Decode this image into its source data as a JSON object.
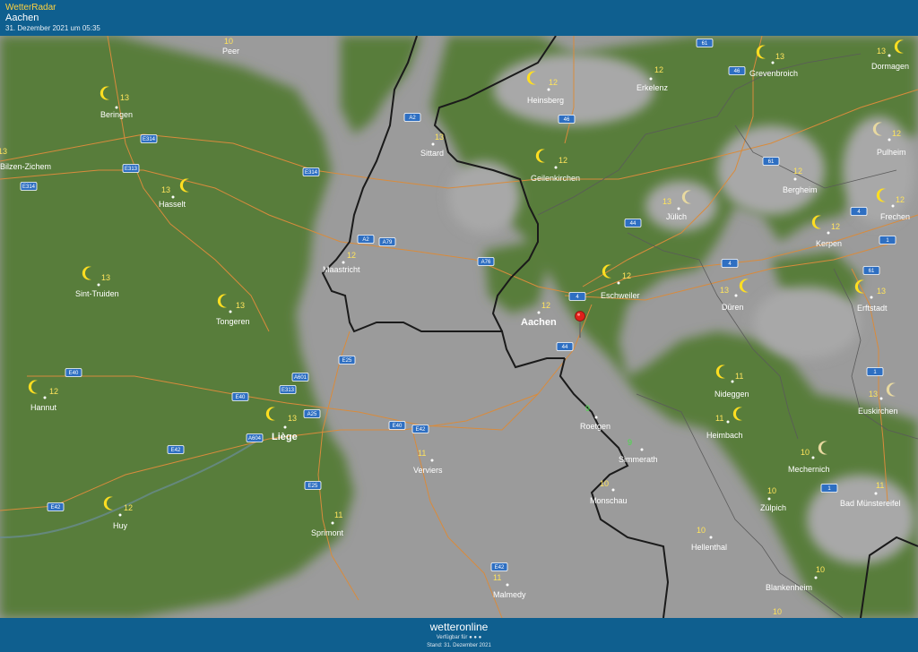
{
  "header": {
    "app_title": "WetterRadar",
    "location": "Aachen",
    "timestamp": "31. Dezember 2021 um 05:35"
  },
  "footer": {
    "logo": "wetteronline",
    "available_for": "Verfügbar für",
    "stand": "Stand: 31. Dezember 2021"
  },
  "colors": {
    "bar": "#0f5f8f",
    "land_green": "#5a7f3b",
    "cloud_gray": "#9a9a9a",
    "road": "#d98b3c",
    "border": "#1a1a1a",
    "temp": "#ffe45c",
    "marker": "#e0201b"
  },
  "cities": [
    {
      "name": "Peer",
      "temp": "10"
    },
    {
      "name": "Beringen",
      "temp": "13"
    },
    {
      "name": "Hasselt",
      "temp": "13"
    },
    {
      "name": "Sint-Truiden",
      "temp": "13"
    },
    {
      "name": "Tongeren",
      "temp": "13"
    },
    {
      "name": "Hannut",
      "temp": "12"
    },
    {
      "name": "Liège",
      "temp": "13"
    },
    {
      "name": "Huy",
      "temp": "12"
    },
    {
      "name": "Maastricht",
      "temp": "12"
    },
    {
      "name": "Sittard",
      "temp": "13"
    },
    {
      "name": "Heinsberg",
      "temp": "12"
    },
    {
      "name": "Geilenkirchen",
      "temp": "12"
    },
    {
      "name": "Erkelenz",
      "temp": "12"
    },
    {
      "name": "Grevenbroich",
      "temp": "13"
    },
    {
      "name": "Dormagen",
      "temp": "13"
    },
    {
      "name": "Pulheim",
      "temp": "12"
    },
    {
      "name": "Bergheim",
      "temp": "12"
    },
    {
      "name": "Jülich",
      "temp": "13"
    },
    {
      "name": "Frechen",
      "temp": "12"
    },
    {
      "name": "Kerpen",
      "temp": "12"
    },
    {
      "name": "Erftstadt",
      "temp": "13"
    },
    {
      "name": "Eschweiler",
      "temp": "12"
    },
    {
      "name": "Aachen",
      "temp": "12"
    },
    {
      "name": "Düren",
      "temp": "13"
    },
    {
      "name": "Nideggen",
      "temp": "11"
    },
    {
      "name": "Euskirchen",
      "temp": "13"
    },
    {
      "name": "Heimbach",
      "temp": "11"
    },
    {
      "name": "Roetgen",
      "temp": "9"
    },
    {
      "name": "Simmerath",
      "temp": "9"
    },
    {
      "name": "Verviers",
      "temp": "11"
    },
    {
      "name": "Monschau",
      "temp": "10"
    },
    {
      "name": "Mechernich",
      "temp": "10"
    },
    {
      "name": "Zülpich",
      "temp": "10"
    },
    {
      "name": "Bad Münstereifel",
      "temp": "11"
    },
    {
      "name": "Sprimont",
      "temp": "11"
    },
    {
      "name": "Hellenthal",
      "temp": "10"
    },
    {
      "name": "Blankenheim",
      "temp": "10"
    },
    {
      "name": "Malmedy",
      "temp": "11"
    },
    {
      "name": "Bilzen-Zichem",
      "temp": "13"
    }
  ],
  "roads": [
    "E314",
    "E313",
    "E314",
    "E314",
    "E40",
    "E40",
    "E42",
    "E42",
    "E25",
    "E25",
    "E40",
    "E42",
    "E42",
    "A2",
    "A2",
    "A79",
    "A76",
    "A601",
    "E313",
    "A25",
    "A604",
    "46",
    "61",
    "46",
    "61",
    "4",
    "44",
    "44",
    "4",
    "1",
    "1",
    "61",
    "4",
    "1"
  ]
}
